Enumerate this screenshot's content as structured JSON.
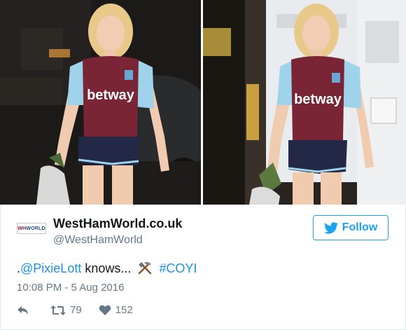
{
  "account": {
    "avatar_text_a": "WH",
    "avatar_text_b": "WORLD",
    "name": "WestHamWorld.co.uk",
    "handle": "@WestHamWorld"
  },
  "follow_label": "Follow",
  "tweet": {
    "prefix": ".",
    "mention": "@PixieLott",
    "text": " knows...",
    "emoji": "hammer-and-pick-icon",
    "hashtag": "#COYI"
  },
  "timestamp": "10:08 PM - 5 Aug 2016",
  "actions": {
    "retweets": "79",
    "likes": "152"
  },
  "shirt": {
    "sponsor": "betway"
  },
  "colors": {
    "accent": "#1da1f2",
    "link": "#1b95e0",
    "claret": "#7a2535",
    "sky": "#9fd3ec"
  }
}
